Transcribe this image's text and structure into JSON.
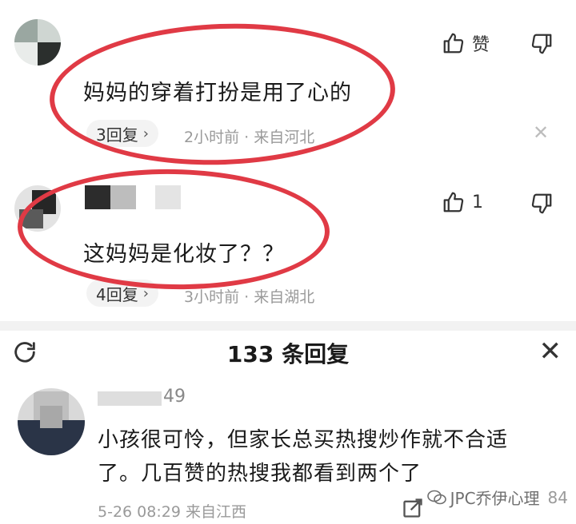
{
  "comments": [
    {
      "text": "妈妈的穿着打扮是用了心的",
      "replies": "3回复",
      "meta": "2小时前 · 来自河北",
      "likes": "赞"
    },
    {
      "text": "这妈妈是化妆了？？",
      "replies": "4回复",
      "meta": "3小时前 · 来自湖北",
      "likes": "1"
    }
  ],
  "panel": {
    "title": "133 条回复"
  },
  "reply": {
    "name_tail": "49",
    "line1": "小孩很可怜，但家长总买热搜炒作就不合适",
    "line2": "了。几百赞的热搜我都看到两个了",
    "meta": "5-26 08:29  来自江西",
    "like_count": "84"
  },
  "watermark": "JPC乔伊心理",
  "colors": {
    "highlight_ring": "#e03a45",
    "text_primary": "#1a1a1a",
    "text_secondary": "#9a9a9a"
  }
}
